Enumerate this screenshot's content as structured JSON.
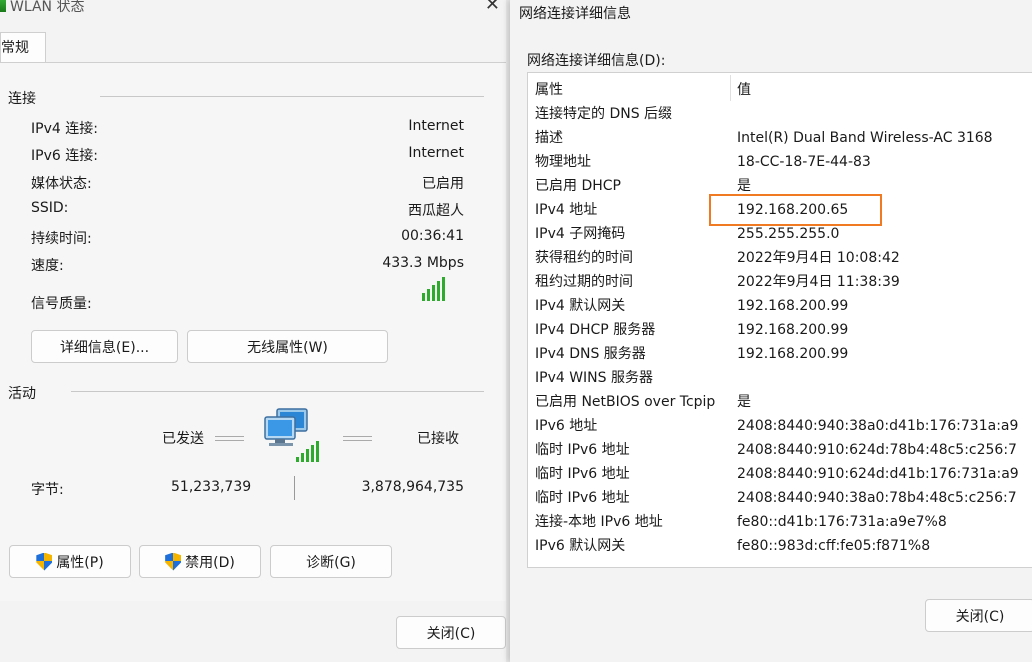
{
  "wlan": {
    "title": "WLAN 状态",
    "tab": "常规",
    "connection": {
      "group": "连接",
      "rows": [
        {
          "label": "IPv4 连接:",
          "value": "Internet"
        },
        {
          "label": "IPv6 连接:",
          "value": "Internet"
        },
        {
          "label": "媒体状态:",
          "value": "已启用"
        },
        {
          "label": "SSID:",
          "value": "西瓜超人"
        },
        {
          "label": "持续时间:",
          "value": "00:36:41"
        },
        {
          "label": "速度:",
          "value": "433.3 Mbps"
        }
      ],
      "signal_label": "信号质量:",
      "signal_bars_filled": 5,
      "signal_bars_total": 5,
      "details_button": "详细信息(E)...",
      "wireless_props_button": "无线属性(W)"
    },
    "activity": {
      "group": "活动",
      "sent_label": "已发送",
      "received_label": "已接收",
      "bytes_label": "字节:",
      "sent_bytes": "51,233,739",
      "received_bytes": "3,878,964,735"
    },
    "buttons": {
      "properties": "属性(P)",
      "disable": "禁用(D)",
      "diagnose": "诊断(G)",
      "close": "关闭(C)"
    },
    "accent_color": "#2eaa2e"
  },
  "details": {
    "title": "网络连接详细信息",
    "caption": "网络连接详细信息(D):",
    "columns": {
      "property": "属性",
      "value": "值"
    },
    "rows": [
      {
        "p": "连接特定的 DNS 后缀",
        "v": ""
      },
      {
        "p": "描述",
        "v": "Intel(R) Dual Band Wireless-AC 3168"
      },
      {
        "p": "物理地址",
        "v": "18-CC-18-7E-44-83"
      },
      {
        "p": "已启用 DHCP",
        "v": "是"
      },
      {
        "p": "IPv4 地址",
        "v": "192.168.200.65"
      },
      {
        "p": "IPv4 子网掩码",
        "v": "255.255.255.0"
      },
      {
        "p": "获得租约的时间",
        "v": "2022年9月4日 10:08:42"
      },
      {
        "p": "租约过期的时间",
        "v": "2022年9月4日 11:38:39"
      },
      {
        "p": "IPv4 默认网关",
        "v": "192.168.200.99"
      },
      {
        "p": "IPv4 DHCP 服务器",
        "v": "192.168.200.99"
      },
      {
        "p": "IPv4 DNS 服务器",
        "v": "192.168.200.99"
      },
      {
        "p": "IPv4 WINS 服务器",
        "v": ""
      },
      {
        "p": "已启用 NetBIOS over Tcpip",
        "v": "是"
      },
      {
        "p": "IPv6 地址",
        "v": "2408:8440:940:38a0:d41b:176:731a:a9"
      },
      {
        "p": "临时 IPv6 地址",
        "v": "2408:8440:910:624d:78b4:48c5:c256:7"
      },
      {
        "p": "临时 IPv6 地址",
        "v": "2408:8440:910:624d:d41b:176:731a:a9"
      },
      {
        "p": "临时 IPv6 地址",
        "v": "2408:8440:940:38a0:78b4:48c5:c256:7"
      },
      {
        "p": "连接-本地 IPv6 地址",
        "v": "fe80::d41b:176:731a:a9e7%8"
      },
      {
        "p": "IPv6 默认网关",
        "v": "fe80::983d:cff:fe05:f871%8"
      }
    ],
    "highlighted_row": "IPv4 地址",
    "highlight_color": "#ef7a22",
    "close_button": "关闭(C)"
  }
}
